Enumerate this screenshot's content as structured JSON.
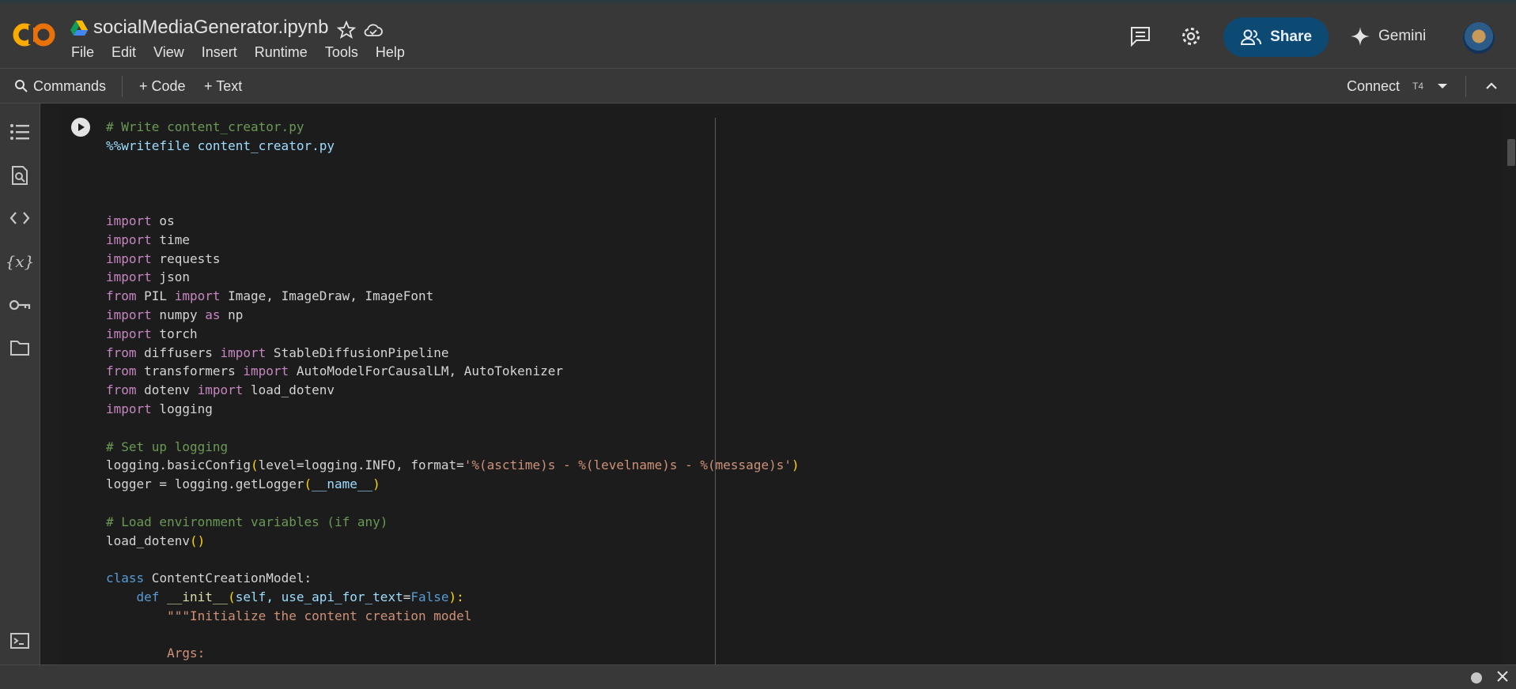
{
  "app": {
    "title": "socialMediaGenerator.ipynb",
    "menu": [
      "File",
      "Edit",
      "View",
      "Insert",
      "Runtime",
      "Tools",
      "Help"
    ],
    "share_label": "Share",
    "gemini_label": "Gemini"
  },
  "toolbar": {
    "commands_label": "Commands",
    "add_code_label": "+ Code",
    "add_text_label": "+ Text",
    "connect_label": "Connect",
    "runtime_type": "T4"
  },
  "sidebar": {
    "icons": [
      "table-of-contents-icon",
      "find-replace-icon",
      "code-snippets-icon",
      "variables-icon",
      "secrets-key-icon",
      "files-folder-icon",
      "terminal-icon"
    ]
  },
  "cell": {
    "lines": [
      [
        {
          "t": "# Write content_creator.py",
          "c": "c"
        }
      ],
      [
        {
          "t": "%%writefile content_creator.py",
          "c": "m"
        }
      ],
      [],
      [],
      [],
      [
        {
          "t": "import",
          "c": "k"
        },
        {
          "t": " os",
          "c": "n"
        }
      ],
      [
        {
          "t": "import",
          "c": "k"
        },
        {
          "t": " time",
          "c": "n"
        }
      ],
      [
        {
          "t": "import",
          "c": "k"
        },
        {
          "t": " requests",
          "c": "n"
        }
      ],
      [
        {
          "t": "import",
          "c": "k"
        },
        {
          "t": " json",
          "c": "n"
        }
      ],
      [
        {
          "t": "from",
          "c": "k"
        },
        {
          "t": " PIL ",
          "c": "n"
        },
        {
          "t": "import",
          "c": "k"
        },
        {
          "t": " Image, ImageDraw, ImageFont",
          "c": "n"
        }
      ],
      [
        {
          "t": "import",
          "c": "k"
        },
        {
          "t": " numpy ",
          "c": "n"
        },
        {
          "t": "as",
          "c": "k"
        },
        {
          "t": " np",
          "c": "n"
        }
      ],
      [
        {
          "t": "import",
          "c": "k"
        },
        {
          "t": " torch",
          "c": "n"
        }
      ],
      [
        {
          "t": "from",
          "c": "k"
        },
        {
          "t": " diffusers ",
          "c": "n"
        },
        {
          "t": "import",
          "c": "k"
        },
        {
          "t": " StableDiffusionPipeline",
          "c": "n"
        }
      ],
      [
        {
          "t": "from",
          "c": "k"
        },
        {
          "t": " transformers ",
          "c": "n"
        },
        {
          "t": "import",
          "c": "k"
        },
        {
          "t": " AutoModelForCausalLM, AutoTokenizer",
          "c": "n"
        }
      ],
      [
        {
          "t": "from",
          "c": "k"
        },
        {
          "t": " dotenv ",
          "c": "n"
        },
        {
          "t": "import",
          "c": "k"
        },
        {
          "t": " load_dotenv",
          "c": "n"
        }
      ],
      [
        {
          "t": "import",
          "c": "k"
        },
        {
          "t": " logging",
          "c": "n"
        }
      ],
      [],
      [
        {
          "t": "# Set up logging",
          "c": "c"
        }
      ],
      [
        {
          "t": "logging.basicConfig",
          "c": "n"
        },
        {
          "t": "(",
          "c": "y"
        },
        {
          "t": "level=logging.INFO, format=",
          "c": "n"
        },
        {
          "t": "'%(asctime)s - %(levelname)s - %(message)s'",
          "c": "s"
        },
        {
          "t": ")",
          "c": "y"
        }
      ],
      [
        {
          "t": "logger = logging.getLogger",
          "c": "n"
        },
        {
          "t": "(",
          "c": "y"
        },
        {
          "t": "__name__",
          "c": "m"
        },
        {
          "t": ")",
          "c": "y"
        }
      ],
      [],
      [
        {
          "t": "# Load environment variables (if any)",
          "c": "c"
        }
      ],
      [
        {
          "t": "load_dotenv",
          "c": "n"
        },
        {
          "t": "()",
          "c": "y"
        }
      ],
      [],
      [
        {
          "t": "class",
          "c": "b"
        },
        {
          "t": " ContentCreationModel:",
          "c": "n"
        }
      ],
      [
        {
          "t": "    ",
          "c": "n"
        },
        {
          "t": "def",
          "c": "b"
        },
        {
          "t": " __init__",
          "c": "f"
        },
        {
          "t": "(",
          "c": "y"
        },
        {
          "t": "self, use_api_for_text",
          "c": "m"
        },
        {
          "t": "=",
          "c": "n"
        },
        {
          "t": "False",
          "c": "b"
        },
        {
          "t": "):",
          "c": "y"
        }
      ],
      [
        {
          "t": "        ",
          "c": "n"
        },
        {
          "t": "\"\"\"Initialize the content creation model",
          "c": "s"
        }
      ],
      [],
      [
        {
          "t": "        ",
          "c": "n"
        },
        {
          "t": "Args:",
          "c": "s"
        }
      ]
    ]
  }
}
